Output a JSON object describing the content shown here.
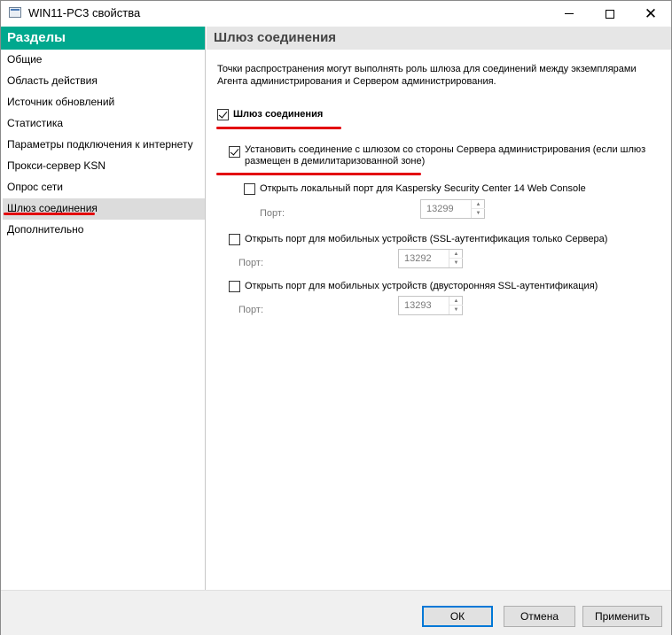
{
  "window": {
    "title": "WIN11-PC3 свойства"
  },
  "sidebar": {
    "header": "Разделы",
    "items": [
      {
        "label": "Общие"
      },
      {
        "label": "Область действия"
      },
      {
        "label": "Источник обновлений"
      },
      {
        "label": "Статистика"
      },
      {
        "label": "Параметры подключения к интернету"
      },
      {
        "label": "Прокси-сервер KSN"
      },
      {
        "label": "Опрос сети"
      },
      {
        "label": "Шлюз соединения"
      },
      {
        "label": "Дополнительно"
      }
    ],
    "active_item": "Шлюз соединения"
  },
  "content": {
    "header": "Шлюз соединения",
    "description": "Точки распространения могут выполнять роль шлюза для соединений между экземплярами Агента администрирования и Сервером администрирования.",
    "gateway_checkbox": {
      "label": "Шлюз соединения",
      "checked": true
    },
    "dmz_checkbox": {
      "label": "Установить соединение с шлюзом со стороны Сервера администрирования (если шлюз размещен в демилитаризованной зоне)",
      "checked": true
    },
    "web_console_port": {
      "label": "Открыть локальный порт для Kaspersky Security Center 14 Web Console",
      "checked": false,
      "port_label": "Порт:",
      "port_value": "13299"
    },
    "mobile_ssl_server": {
      "label": "Открыть порт для мобильных устройств (SSL-аутентификация только Сервера)",
      "checked": false,
      "port_label": "Порт:",
      "port_value": "13292"
    },
    "mobile_ssl_mutual": {
      "label": "Открыть порт для мобильных устройств (двусторонняя SSL-аутентификация)",
      "checked": false,
      "port_label": "Порт:",
      "port_value": "13293"
    }
  },
  "footer": {
    "ok_label": "ОК",
    "cancel_label": "Отмена",
    "apply_label": "Применить"
  },
  "colors": {
    "sidebar_header_bg": "#00a88e",
    "annotation_red": "#e3000b",
    "active_item_bg": "#dcdcdc",
    "primary_button_border": "#0078d7"
  }
}
